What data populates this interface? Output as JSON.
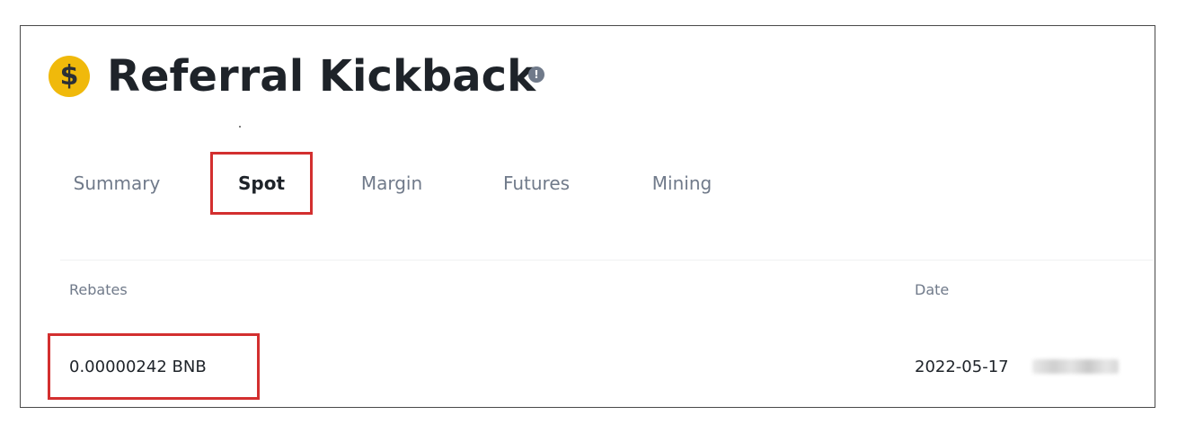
{
  "header": {
    "title": "Referral Kickback",
    "coin_icon": "dollar-coin-icon",
    "coin_symbol": "$",
    "info_icon": "info-icon",
    "info_symbol": "!"
  },
  "tabs": [
    {
      "label": "Summary",
      "active": false
    },
    {
      "label": "Spot",
      "active": true
    },
    {
      "label": "Margin",
      "active": false
    },
    {
      "label": "Futures",
      "active": false
    },
    {
      "label": "Mining",
      "active": false
    }
  ],
  "table": {
    "columns": [
      "Rebates",
      "Date"
    ],
    "rows": [
      {
        "rebates": "0.00000242 BNB",
        "date": "2022-05-17"
      }
    ]
  },
  "colors": {
    "accent": "#f0b90b",
    "highlight_box": "#d32f2f",
    "text_primary": "#1e2329",
    "text_secondary": "#707a8a"
  }
}
